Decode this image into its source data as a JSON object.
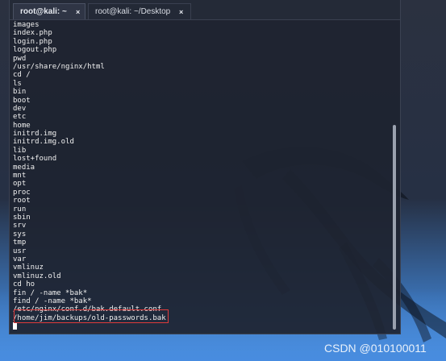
{
  "tabs": [
    {
      "label": "root@kali: ~",
      "close": "×",
      "active": true
    },
    {
      "label": "root@kali: ~/Desktop",
      "close": "×",
      "active": false
    }
  ],
  "terminal": {
    "lines": [
      "images",
      "index.php",
      "login.php",
      "logout.php",
      "pwd",
      "/usr/share/nginx/html",
      "cd /",
      "ls",
      "bin",
      "boot",
      "dev",
      "etc",
      "home",
      "initrd.img",
      "initrd.img.old",
      "lib",
      "lost+found",
      "media",
      "mnt",
      "opt",
      "proc",
      "root",
      "run",
      "sbin",
      "srv",
      "sys",
      "tmp",
      "usr",
      "var",
      "vmlinuz",
      "vmlinuz.old",
      "cd ho",
      "fin / -name *bak*",
      "find / -name *bak*",
      "/etc/nginx/conf.d/bak.default.conf",
      "/home/jim/backups/old-passwords.bak"
    ]
  },
  "watermark": "CSDN @010100011",
  "colors": {
    "terminal_bg": "#1e2430",
    "text": "#f0f0f0",
    "highlight": "#e03b3b",
    "desktop_accent": "#4f8fd8"
  }
}
